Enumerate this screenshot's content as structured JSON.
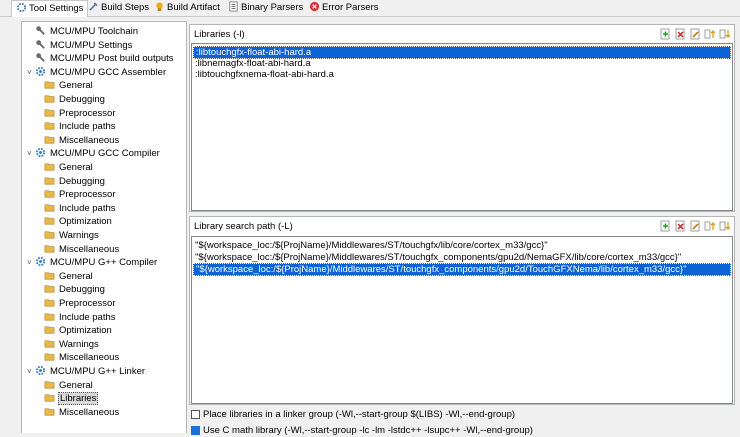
{
  "tabs": [
    {
      "label": "Tool Settings",
      "icon": "tool-settings-icon",
      "active": true
    },
    {
      "label": "Build Steps",
      "icon": "build-steps-icon",
      "active": false
    },
    {
      "label": "Build Artifact",
      "icon": "build-artifact-icon",
      "active": false
    },
    {
      "label": "Binary Parsers",
      "icon": "binary-parsers-icon",
      "active": false
    },
    {
      "label": "Error Parsers",
      "icon": "error-parsers-icon",
      "active": false
    }
  ],
  "tree": [
    {
      "label": "MCU/MPU Toolchain",
      "level": 0,
      "kind": "tool",
      "expand": ""
    },
    {
      "label": "MCU/MPU Settings",
      "level": 0,
      "kind": "tool",
      "expand": ""
    },
    {
      "label": "MCU/MPU Post build outputs",
      "level": 0,
      "kind": "tool",
      "expand": ""
    },
    {
      "label": "MCU/MPU GCC Assembler",
      "level": 0,
      "kind": "gear",
      "expand": "v"
    },
    {
      "label": "General",
      "level": 1,
      "kind": "folder"
    },
    {
      "label": "Debugging",
      "level": 1,
      "kind": "folder"
    },
    {
      "label": "Preprocessor",
      "level": 1,
      "kind": "folder"
    },
    {
      "label": "Include paths",
      "level": 1,
      "kind": "folder"
    },
    {
      "label": "Miscellaneous",
      "level": 1,
      "kind": "folder"
    },
    {
      "label": "MCU/MPU GCC Compiler",
      "level": 0,
      "kind": "gear",
      "expand": "v"
    },
    {
      "label": "General",
      "level": 1,
      "kind": "folder"
    },
    {
      "label": "Debugging",
      "level": 1,
      "kind": "folder"
    },
    {
      "label": "Preprocessor",
      "level": 1,
      "kind": "folder"
    },
    {
      "label": "Include paths",
      "level": 1,
      "kind": "folder"
    },
    {
      "label": "Optimization",
      "level": 1,
      "kind": "folder"
    },
    {
      "label": "Warnings",
      "level": 1,
      "kind": "folder"
    },
    {
      "label": "Miscellaneous",
      "level": 1,
      "kind": "folder"
    },
    {
      "label": "MCU/MPU G++ Compiler",
      "level": 0,
      "kind": "gear",
      "expand": "v"
    },
    {
      "label": "General",
      "level": 1,
      "kind": "folder"
    },
    {
      "label": "Debugging",
      "level": 1,
      "kind": "folder"
    },
    {
      "label": "Preprocessor",
      "level": 1,
      "kind": "folder"
    },
    {
      "label": "Include paths",
      "level": 1,
      "kind": "folder"
    },
    {
      "label": "Optimization",
      "level": 1,
      "kind": "folder"
    },
    {
      "label": "Warnings",
      "level": 1,
      "kind": "folder"
    },
    {
      "label": "Miscellaneous",
      "level": 1,
      "kind": "folder"
    },
    {
      "label": "MCU/MPU G++ Linker",
      "level": 0,
      "kind": "gear",
      "expand": "v"
    },
    {
      "label": "General",
      "level": 1,
      "kind": "folder"
    },
    {
      "label": "Libraries",
      "level": 1,
      "kind": "folder",
      "selected": true
    },
    {
      "label": "Miscellaneous",
      "level": 1,
      "kind": "folder"
    }
  ],
  "libraries": {
    "title": "Libraries (-l)",
    "items": [
      {
        "text": ":libtouchgfx-float-abi-hard.a",
        "selected": true
      },
      {
        "text": ":libnemagfx-float-abi-hard.a",
        "selected": false
      },
      {
        "text": ":libtouchgfxnema-float-abi-hard.a",
        "selected": false
      }
    ],
    "toolbar": [
      "add-icon",
      "delete-icon",
      "edit-icon",
      "move-up-icon",
      "move-down-icon"
    ]
  },
  "search_path": {
    "title": "Library search path (-L)",
    "items": [
      {
        "text": "\"${workspace_loc:/${ProjName}/Middlewares/ST/touchgfx/lib/core/cortex_m33/gcc}\"",
        "selected": false
      },
      {
        "text": "\"${workspace_loc:/${ProjName}/Middlewares/ST/touchgfx_components/gpu2d/NemaGFX/lib/core/cortex_m33/gcc}\"",
        "selected": false
      },
      {
        "text": "\"${workspace_loc:/${ProjName}/Middlewares/ST/touchgfx_components/gpu2d/TouchGFXNema/lib/cortex_m33/gcc}\"",
        "selected": true
      }
    ],
    "toolbar": [
      "add-icon",
      "delete-icon",
      "edit-icon",
      "move-up-icon",
      "move-down-icon"
    ]
  },
  "options": [
    {
      "label": "Place libraries in a linker group (-Wl,--start-group $(LIBS) -Wl,--end-group)",
      "checked": false
    },
    {
      "label": "Use C math library (-Wl,--start-group -lc -lm -lstdc++ -lsupc++ -Wl,--end-group)",
      "checked": true
    }
  ],
  "colors": {
    "selection": "#0a64d6",
    "folder": "#e8b84a",
    "gear": "#3a7fc8"
  }
}
